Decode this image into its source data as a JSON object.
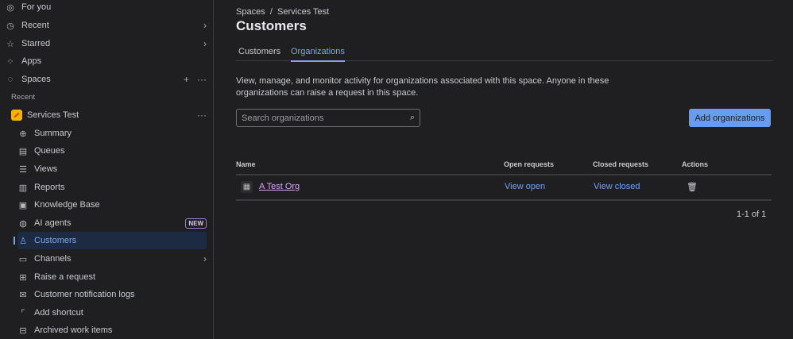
{
  "sidebar": {
    "top": [
      {
        "label": "For you",
        "icon": "user-circle-icon"
      },
      {
        "label": "Recent",
        "icon": "clock-icon"
      },
      {
        "label": "Starred",
        "icon": "star-icon"
      },
      {
        "label": "Apps",
        "icon": "apps-icon"
      },
      {
        "label": "Spaces",
        "icon": "planet-icon"
      }
    ],
    "recent_label": "Recent",
    "space": "Services Test",
    "items": [
      {
        "label": "Summary"
      },
      {
        "label": "Queues"
      },
      {
        "label": "Views"
      },
      {
        "label": "Reports"
      },
      {
        "label": "Knowledge Base"
      },
      {
        "label": "AI agents",
        "badge": "NEW"
      },
      {
        "label": "Customers"
      },
      {
        "label": "Channels"
      },
      {
        "label": "Raise a request"
      },
      {
        "label": "Customer notification logs"
      },
      {
        "label": "Add shortcut"
      },
      {
        "label": "Archived work items"
      }
    ]
  },
  "breadcrumb": {
    "root": "Spaces",
    "sep": "/",
    "current": "Services Test"
  },
  "title": "Customers",
  "tabs": [
    "Customers",
    "Organizations"
  ],
  "description": "View, manage, and monitor activity for organizations associated with this space. Anyone in these organizations can raise a request in this space.",
  "search": {
    "placeholder": "Search organizations"
  },
  "add_button": "Add organizations",
  "table": {
    "headers": [
      "Name",
      "Open requests",
      "Closed requests",
      "Actions"
    ],
    "rows": [
      {
        "name": "A Test Org",
        "open": "View open",
        "closed": "View closed"
      }
    ]
  },
  "pagination": "1-1 of 1",
  "colors": {
    "accent": "#669df1",
    "background": "#1f1f21"
  }
}
